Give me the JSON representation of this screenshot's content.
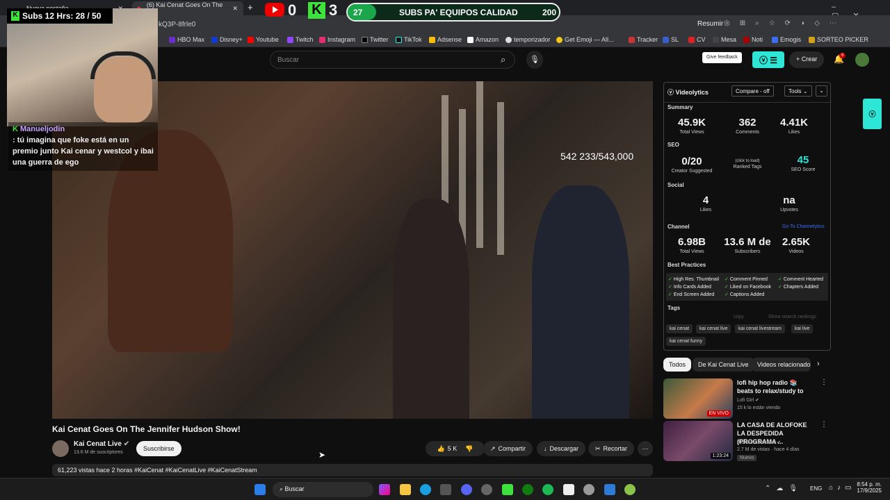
{
  "browser": {
    "tabs": [
      {
        "label": "Nueva pestaña"
      },
      {
        "label": "(6) Kai Cenat Goes On The Je"
      }
    ],
    "address_partial": "kQ3P-8frle0",
    "resume_label": "Resumir",
    "bookmarks": [
      "HBO Max",
      "Disney+",
      "Youtube",
      "Twitch",
      "Instagram",
      "Twitter",
      "TikTok",
      "Adsense",
      "Amazon",
      "temporizador",
      "Get Emoji — All...",
      "Tracker",
      "SL",
      "CV",
      "Mesa",
      "Noti",
      "Emogis",
      "SORTEO PICKER"
    ]
  },
  "overlay": {
    "subs_label": "Subs 12 Hrs: 28 / 50",
    "yt_count": "0",
    "k_count": "3",
    "bar_left": "27",
    "bar_label": "SUBS PA' EQUIPOS CALIDAD",
    "bar_right": "200",
    "chat_prev_user": "Manuejodin",
    "chat_user": "Manueljodin",
    "chat_message": ": tú imagina que foke está en un premio junto Kai cenar y westcol y ibai una guerra de ego",
    "counter": "542 233/543,000",
    "k_letter": "K"
  },
  "youtube": {
    "search_placeholder": "Buscar",
    "give_feedback": "Give feedback",
    "create_label": "Crear",
    "notif_count": "6",
    "video_title": "Kai Cenat Goes On The Jennifer Hudson Show!",
    "channel_name": "Kai Cenat Live",
    "channel_subs": "13.6 M de suscriptores",
    "subscribe_label": "Suscribirse",
    "likes": "5 K",
    "share_label": "Compartir",
    "download_label": "Descargar",
    "clip_label": "Recortar",
    "description": "61,223 vistas  hace 2 horas  #KaiCenat #KaiCenatLive #KaiCenatStream"
  },
  "videolytics": {
    "title": "Videolytics",
    "compare_label": "Compare - off",
    "tools_label": "Tools",
    "summary_label": "Summary",
    "summary": [
      {
        "value": "45.9K",
        "label": "Total Views"
      },
      {
        "value": "362",
        "label": "Comments"
      },
      {
        "value": "4.41K",
        "label": "Likes"
      }
    ],
    "seo_label": "SEO",
    "seo_creator": {
      "value": "0/20",
      "label": "Creator Suggested"
    },
    "seo_ranked": {
      "value": "(click to load)",
      "label": "Ranked Tags"
    },
    "seo_score": {
      "value": "45",
      "label": "SEO Score"
    },
    "social_label": "Social",
    "social_likes": {
      "value": "4",
      "label": "Likes"
    },
    "social_upvotes": {
      "value": "na",
      "label": "Upvotes"
    },
    "channel_label": "Channel",
    "goto_channel": "Go To Channelytics",
    "channel": [
      {
        "value": "6.98B",
        "label": "Total Views"
      },
      {
        "value": "13.6 M de",
        "label": "Subscribers"
      },
      {
        "value": "2.65K",
        "label": "Videos"
      }
    ],
    "best_label": "Best Practices",
    "best": [
      "High Res. Thumbnail",
      "Comment Pinned",
      "Comment Hearted",
      "Info Cards Added",
      "Liked on Facebook",
      "Chapters Added",
      "End Screen Added",
      "Captions Added"
    ],
    "tags_label": "Tags",
    "copy_label": "copy",
    "show_rankings": "Show search rankings",
    "tags": [
      "kai cenat",
      "kai cenat live",
      "kai cenat livestream",
      "kai live",
      "kai cenat funny"
    ]
  },
  "chips": [
    "Todos",
    "De Kai Cenat Live",
    "Videos relacionados"
  ],
  "related": [
    {
      "title": "lofi hip hop radio 📚 beats to relax/study to",
      "channel": "Lofi Girl",
      "meta": "15 k lo están viendo",
      "badge": "EN VIVO"
    },
    {
      "title": "LA CASA DE ALOFOKE LA DESPEDIDA (PROGRAMA ...",
      "channel": "Alofokeradioshow",
      "meta": "2.7 M de vistas · hace 4 días",
      "badge": "1:23:24",
      "extra": "Nuevo"
    }
  ],
  "taskbar": {
    "search_label": "Buscar",
    "lang": "ENG",
    "time": "8:54 p. m.",
    "date": "17/9/2025"
  }
}
